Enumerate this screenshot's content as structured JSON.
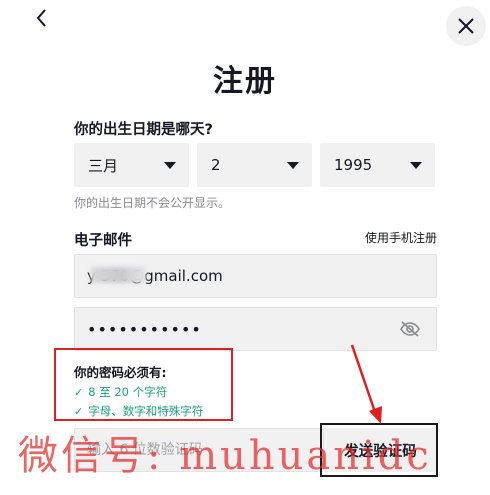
{
  "header": {
    "title": "注册"
  },
  "birthday": {
    "label": "你的出生日期是哪天?",
    "month": "三月",
    "day": "2",
    "year": "1995",
    "hint": "你的出生日期不会公开显示。"
  },
  "email": {
    "label": "电子邮件",
    "switch_link": "使用手机注册",
    "value": "y 370@gmail.com"
  },
  "password": {
    "value": "•••••••••••"
  },
  "requirements": {
    "title": "你的密码必须有:",
    "items": [
      "8 至 20 个字符",
      "字母、数字和特殊字符"
    ]
  },
  "verification": {
    "placeholder": "输入 6 位数验证码",
    "send_button": "发送验证码"
  },
  "watermark": "微信号: muhuanidc",
  "colors": {
    "accent_red": "#e02020",
    "success_green": "#1aa57c",
    "field_bg": "#f1f1f2"
  }
}
